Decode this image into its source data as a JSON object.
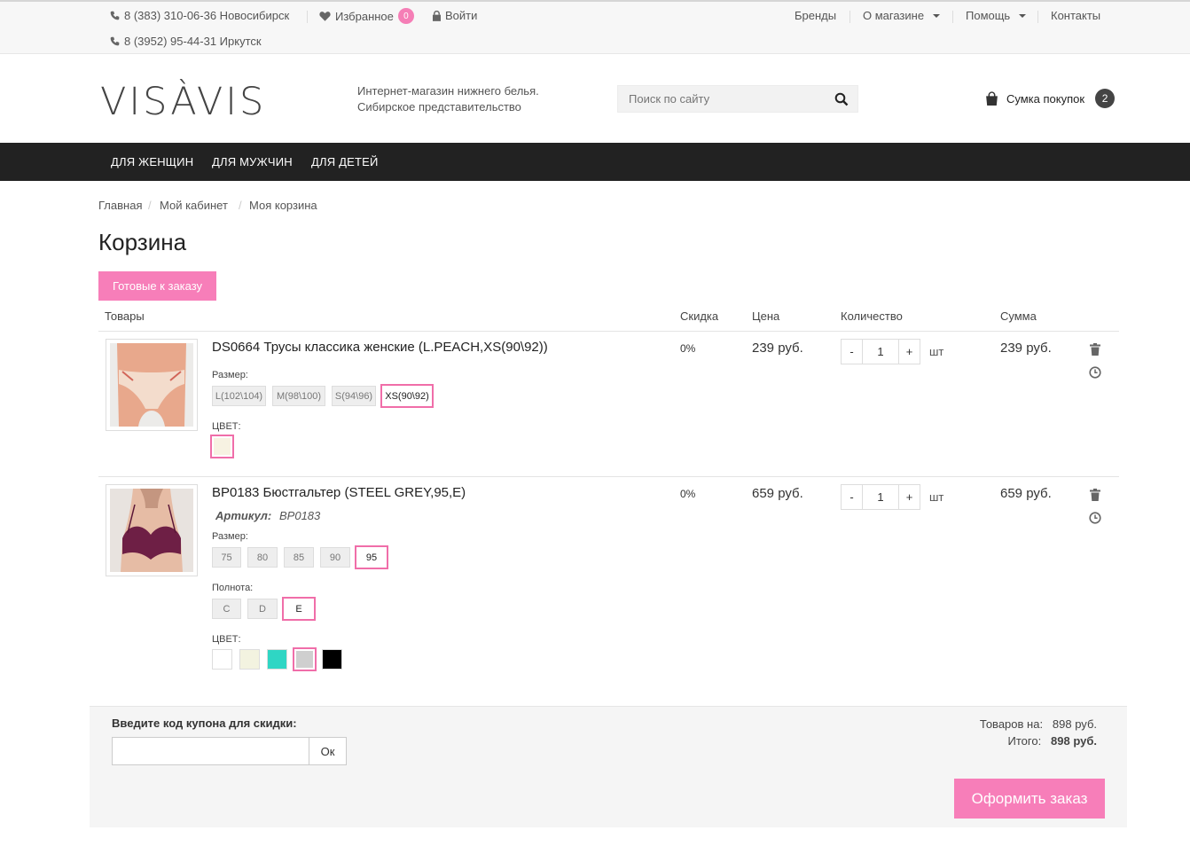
{
  "topbar": {
    "phone1": "8 (383) 310-06-36 Новосибирск",
    "favorites_label": "Избранное",
    "favorites_count": "0",
    "login_label": "Войти",
    "phone2": "8 (3952) 95-44-31 Иркутск",
    "links": [
      "Бренды",
      "О магазине",
      "Помощь",
      "Контакты"
    ]
  },
  "header": {
    "logo_text": "VISÀVIS",
    "tagline_line1": "Интернет-магазин нижнего белья.",
    "tagline_line2": "Сибирское представительство",
    "search_placeholder": "Поиск по сайту",
    "bag_label": "Сумка покупок",
    "bag_count": "2"
  },
  "nav": {
    "items": [
      "ДЛЯ ЖЕНЩИН",
      "ДЛЯ МУЖЧИН",
      "ДЛЯ ДЕТЕЙ"
    ]
  },
  "breadcrumb": [
    "Главная",
    "Мой кабинет",
    "Моя корзина"
  ],
  "page_title": "Корзина",
  "ready_button": "Готовые к заказу",
  "table_headers": {
    "items": "Товары",
    "discount": "Скидка",
    "price": "Цена",
    "quantity": "Количество",
    "sum": "Сумма"
  },
  "products": [
    {
      "title": "DS0664 Трусы классика женские (L.PEACH,XS(90\\92))",
      "size_label": "Размер:",
      "sizes": [
        "L(102\\104)",
        "M(98\\100)",
        "S(94\\96)",
        "XS(90\\92)"
      ],
      "selected_size": "XS(90\\92)",
      "color_label": "ЦВЕТ:",
      "discount": "0%",
      "price": "239 руб.",
      "qty": "1",
      "unit": "шт",
      "sum": "239 руб."
    },
    {
      "title": "BP0183 Бюстгальтер (STEEL GREY,95,E)",
      "article_label": "Артикул:",
      "article": "BP0183",
      "size_label": "Размер:",
      "sizes": [
        "75",
        "80",
        "85",
        "90",
        "95"
      ],
      "selected_size": "95",
      "fullness_label": "Полнота:",
      "fullness": [
        "C",
        "D",
        "E"
      ],
      "selected_fullness": "E",
      "color_label": "ЦВЕТ:",
      "colors": [
        "#ffffff",
        "#f3f3e0",
        "#2fd6c4",
        "#cfcfcf",
        "#000000"
      ],
      "selected_color": "#cfcfcf",
      "discount": "0%",
      "price": "659 руб.",
      "qty": "1",
      "unit": "шт",
      "sum": "659 руб."
    }
  ],
  "product1_color": "#f7f2e2",
  "qty_minus": "-",
  "qty_plus": "+",
  "coupon": {
    "label": "Введите код купона для скидки:",
    "button": "Ок"
  },
  "totals": {
    "goods_label": "Товаров на:",
    "goods_value": "898 руб.",
    "total_label": "Итого:",
    "total_value": "898 руб."
  },
  "order_button": "Оформить заказ",
  "colors": {
    "accent": "#f77eb9",
    "nav_bg": "#222222"
  }
}
